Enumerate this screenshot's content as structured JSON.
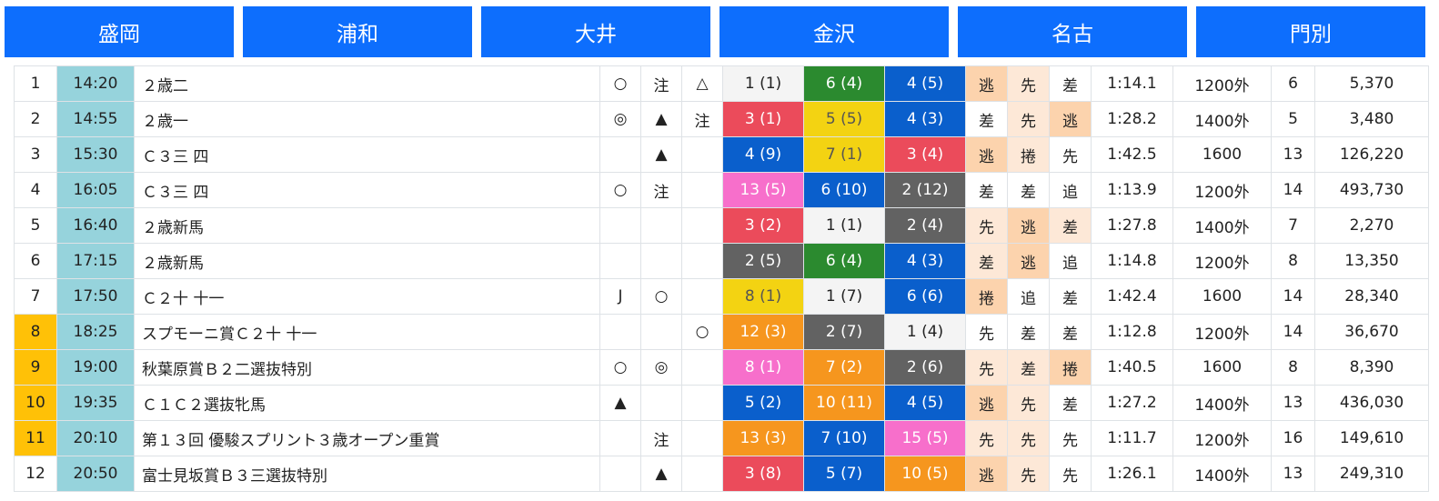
{
  "tabs": [
    "盛岡",
    "浦和",
    "大井",
    "金沢",
    "名古",
    "門別"
  ],
  "races": [
    {
      "num": "1",
      "highlight": false,
      "time": "14:20",
      "name": "２歳二",
      "marks": [
        "○",
        "注",
        "△"
      ],
      "results": [
        {
          "text": "1 (1)",
          "color": "white"
        },
        {
          "text": "6 (4)",
          "color": "green"
        },
        {
          "text": "4 (5)",
          "color": "blue"
        }
      ],
      "styles": [
        {
          "text": "逃",
          "bg": "dark"
        },
        {
          "text": "先",
          "bg": "light"
        },
        {
          "text": "差",
          "bg": "none"
        }
      ],
      "win_time": "1:14.1",
      "distance": "1200外",
      "runners": "6",
      "payout": "5,370"
    },
    {
      "num": "2",
      "highlight": false,
      "time": "14:55",
      "name": "２歳一",
      "marks": [
        "◎",
        "▲",
        "注"
      ],
      "results": [
        {
          "text": "3 (1)",
          "color": "red"
        },
        {
          "text": "5 (5)",
          "color": "yellow"
        },
        {
          "text": "4 (3)",
          "color": "blue"
        }
      ],
      "styles": [
        {
          "text": "差",
          "bg": "none"
        },
        {
          "text": "先",
          "bg": "light"
        },
        {
          "text": "逃",
          "bg": "dark"
        }
      ],
      "win_time": "1:28.2",
      "distance": "1400外",
      "runners": "5",
      "payout": "3,480"
    },
    {
      "num": "3",
      "highlight": false,
      "time": "15:30",
      "name": "Ｃ３三 四",
      "marks": [
        "",
        "▲",
        ""
      ],
      "results": [
        {
          "text": "4 (9)",
          "color": "blue"
        },
        {
          "text": "7 (1)",
          "color": "yellow"
        },
        {
          "text": "3 (4)",
          "color": "red"
        }
      ],
      "styles": [
        {
          "text": "逃",
          "bg": "dark"
        },
        {
          "text": "捲",
          "bg": "light"
        },
        {
          "text": "先",
          "bg": "none"
        }
      ],
      "win_time": "1:42.5",
      "distance": "1600",
      "runners": "13",
      "payout": "126,220"
    },
    {
      "num": "4",
      "highlight": false,
      "time": "16:05",
      "name": "Ｃ３三 四",
      "marks": [
        "○",
        "注",
        ""
      ],
      "results": [
        {
          "text": "13 (5)",
          "color": "pink"
        },
        {
          "text": "6 (10)",
          "color": "blue"
        },
        {
          "text": "2 (12)",
          "color": "black"
        }
      ],
      "styles": [
        {
          "text": "差",
          "bg": "none"
        },
        {
          "text": "差",
          "bg": "none"
        },
        {
          "text": "追",
          "bg": "none"
        }
      ],
      "win_time": "1:13.9",
      "distance": "1200外",
      "runners": "14",
      "payout": "493,730"
    },
    {
      "num": "5",
      "highlight": false,
      "time": "16:40",
      "name": "２歳新馬",
      "marks": [
        "",
        "",
        ""
      ],
      "results": [
        {
          "text": "3 (2)",
          "color": "red"
        },
        {
          "text": "1 (1)",
          "color": "white"
        },
        {
          "text": "2 (4)",
          "color": "black"
        }
      ],
      "styles": [
        {
          "text": "先",
          "bg": "light"
        },
        {
          "text": "逃",
          "bg": "dark"
        },
        {
          "text": "差",
          "bg": "light"
        }
      ],
      "win_time": "1:27.8",
      "distance": "1400外",
      "runners": "7",
      "payout": "2,270"
    },
    {
      "num": "6",
      "highlight": false,
      "time": "17:15",
      "name": "２歳新馬",
      "marks": [
        "",
        "",
        ""
      ],
      "results": [
        {
          "text": "2 (5)",
          "color": "black"
        },
        {
          "text": "6 (4)",
          "color": "green"
        },
        {
          "text": "4 (3)",
          "color": "blue"
        }
      ],
      "styles": [
        {
          "text": "差",
          "bg": "light"
        },
        {
          "text": "逃",
          "bg": "dark"
        },
        {
          "text": "追",
          "bg": "none"
        }
      ],
      "win_time": "1:14.8",
      "distance": "1200外",
      "runners": "8",
      "payout": "13,350"
    },
    {
      "num": "7",
      "highlight": false,
      "time": "17:50",
      "name": "Ｃ２十 十一",
      "marks": [
        "J",
        "○",
        ""
      ],
      "results": [
        {
          "text": "8 (1)",
          "color": "yellow"
        },
        {
          "text": "1 (7)",
          "color": "white"
        },
        {
          "text": "6 (6)",
          "color": "blue"
        }
      ],
      "styles": [
        {
          "text": "捲",
          "bg": "dark"
        },
        {
          "text": "追",
          "bg": "none"
        },
        {
          "text": "差",
          "bg": "none"
        }
      ],
      "win_time": "1:42.4",
      "distance": "1600",
      "runners": "14",
      "payout": "28,340"
    },
    {
      "num": "8",
      "highlight": true,
      "time": "18:25",
      "name": "スプモーニ賞Ｃ２十 十一",
      "marks": [
        "",
        "",
        "○"
      ],
      "results": [
        {
          "text": "12 (3)",
          "color": "orange"
        },
        {
          "text": "2 (7)",
          "color": "black"
        },
        {
          "text": "1 (4)",
          "color": "white"
        }
      ],
      "styles": [
        {
          "text": "先",
          "bg": "none"
        },
        {
          "text": "差",
          "bg": "none"
        },
        {
          "text": "差",
          "bg": "none"
        }
      ],
      "win_time": "1:12.8",
      "distance": "1200外",
      "runners": "14",
      "payout": "36,670"
    },
    {
      "num": "9",
      "highlight": true,
      "time": "19:00",
      "name": "秋葉原賞Ｂ２二選抜特別",
      "marks": [
        "○",
        "◎",
        ""
      ],
      "results": [
        {
          "text": "8 (1)",
          "color": "pink"
        },
        {
          "text": "7 (2)",
          "color": "orange"
        },
        {
          "text": "2 (6)",
          "color": "black"
        }
      ],
      "styles": [
        {
          "text": "先",
          "bg": "light"
        },
        {
          "text": "差",
          "bg": "light"
        },
        {
          "text": "捲",
          "bg": "dark"
        }
      ],
      "win_time": "1:40.5",
      "distance": "1600",
      "runners": "8",
      "payout": "8,390"
    },
    {
      "num": "10",
      "highlight": true,
      "time": "19:35",
      "name": "Ｃ１Ｃ２選抜牝馬",
      "marks": [
        "▲",
        "",
        ""
      ],
      "results": [
        {
          "text": "5 (2)",
          "color": "blue"
        },
        {
          "text": "10 (11)",
          "color": "orange"
        },
        {
          "text": "4 (5)",
          "color": "blue"
        }
      ],
      "styles": [
        {
          "text": "逃",
          "bg": "dark"
        },
        {
          "text": "先",
          "bg": "light"
        },
        {
          "text": "差",
          "bg": "none"
        }
      ],
      "win_time": "1:27.2",
      "distance": "1400外",
      "runners": "13",
      "payout": "436,030"
    },
    {
      "num": "11",
      "highlight": true,
      "time": "20:10",
      "name": "第１３回 優駿スプリント３歳オープン重賞",
      "marks": [
        "",
        "注",
        ""
      ],
      "results": [
        {
          "text": "13 (3)",
          "color": "orange"
        },
        {
          "text": "7 (10)",
          "color": "blue"
        },
        {
          "text": "15 (5)",
          "color": "pink"
        }
      ],
      "styles": [
        {
          "text": "先",
          "bg": "light"
        },
        {
          "text": "先",
          "bg": "light"
        },
        {
          "text": "先",
          "bg": "none"
        }
      ],
      "win_time": "1:11.7",
      "distance": "1200外",
      "runners": "16",
      "payout": "149,610"
    },
    {
      "num": "12",
      "highlight": false,
      "time": "20:50",
      "name": "富士見坂賞Ｂ３三選抜特別",
      "marks": [
        "",
        "▲",
        ""
      ],
      "results": [
        {
          "text": "3 (8)",
          "color": "red"
        },
        {
          "text": "5 (7)",
          "color": "blue"
        },
        {
          "text": "10 (5)",
          "color": "orange"
        }
      ],
      "styles": [
        {
          "text": "逃",
          "bg": "dark"
        },
        {
          "text": "先",
          "bg": "light"
        },
        {
          "text": "先",
          "bg": "none"
        }
      ],
      "win_time": "1:26.1",
      "distance": "1400外",
      "runners": "13",
      "payout": "249,310"
    }
  ]
}
